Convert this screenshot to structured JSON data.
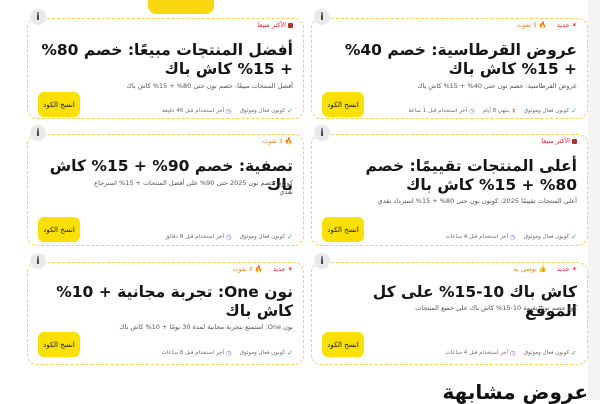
{
  "page": {
    "section_title": "عروض مشابهة"
  },
  "cards": [
    {
      "badges": [
        {
          "text": "جديد",
          "kind": "new"
        },
        {
          "text": "لا تفوت",
          "kind": "hot"
        }
      ],
      "title": "عروض القرطاسية: خصم 40% + 15% كاش باك",
      "desc": "عروض القرطاسية: خصم نون حتى 40% + 15% كاش باك",
      "button": "انسخ الكود",
      "verified": "كوبون فعال وموثوق",
      "ends": "ينتهي 8 أيام",
      "last_used": "آخر استخدام قبل 1 ساعة"
    },
    {
      "badges": [
        {
          "text": "الأكثر مبيعا",
          "kind": "best"
        }
      ],
      "title": "أفضل المنتجات مبيعًا: خصم 80% + 15% كاش باك",
      "desc": "أفضل المنتجات مبيعًا: خصم نون حتى 80% + 15% كاش باك",
      "button": "انسخ الكود",
      "verified": "كوبون فعال وموثوق",
      "last_used": "آخر استخدام قبل 46 دقيقة"
    },
    {
      "badges": [
        {
          "text": "الأكثر مبيعا",
          "kind": "best"
        }
      ],
      "title": "أعلى المنتجات تقييمًا: خصم 80% + 15% كاش باك",
      "desc": "أعلى المنتجات تقييمًا 2025: كوبون نون حتى 80% + 15% استرداد نقدي",
      "button": "انسخ الكود",
      "verified": "كوبون فعال وموثوق",
      "last_used": "آخر استخدام قبل 4 ساعات"
    },
    {
      "badges": [
        {
          "text": "لا تفوت",
          "kind": "hot"
        }
      ],
      "title": "تصفية: خصم 90% + 15% كاش باك",
      "desc": "كوبون خصم نون 2025 حتى 90% على أفضل المنتجات + 15% استرجاع نقدي",
      "button": "انسخ الكود",
      "verified": "كوبون فعال وموثوق",
      "last_used": "آخر استخدام قبل 8 دقائق"
    },
    {
      "badges": [
        {
          "text": "جديد",
          "kind": "new"
        },
        {
          "text": "توصي به",
          "kind": "rec"
        }
      ],
      "title": "كاش باك 10-15% على كل الموقع",
      "desc": "كود خصم نون بقيمة 10-15% كاش باك على جميع المنتجات",
      "button": "انسخ الكود",
      "verified": "كوبون فعال وموثوق",
      "last_used": "آخر استخدام قبل 4 ساعات"
    },
    {
      "badges": [
        {
          "text": "جديد",
          "kind": "new"
        },
        {
          "text": "لا تفوت",
          "kind": "hot"
        }
      ],
      "title": "نون One: تجربة مجانية + 10% كاش باك",
      "desc": "نون One: استمتع بتجربة مجانية لمدة 30 يومًا + 10% كاش باك",
      "button": "انسخ الكود",
      "verified": "كوبون فعال وموثوق",
      "last_used": "آخر استخدام قبل 8 ساعات"
    }
  ]
}
